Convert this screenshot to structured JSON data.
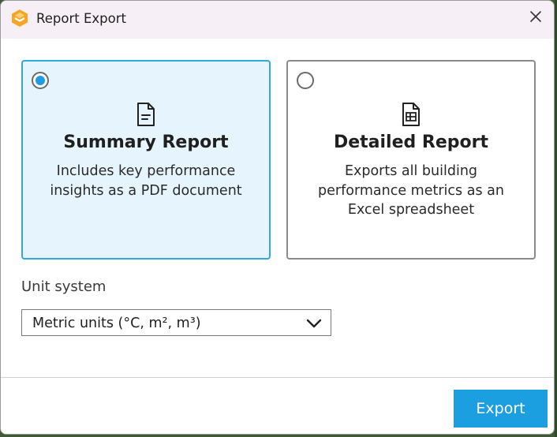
{
  "window": {
    "title": "Report Export",
    "app_icon": "report-export-logo-icon",
    "close_icon": "close-icon"
  },
  "options": [
    {
      "id": "summary",
      "selected": true,
      "icon": "document-icon",
      "title": "Summary Report",
      "description": "Includes key performance insights as a PDF document"
    },
    {
      "id": "detailed",
      "selected": false,
      "icon": "spreadsheet-icon",
      "title": "Detailed Report",
      "description": "Exports all building performance metrics as an Excel spreadsheet"
    }
  ],
  "unit_system": {
    "label": "Unit system",
    "selected_value": "Metric units (°C, m², m³)",
    "chevron_icon": "chevron-down-icon"
  },
  "footer": {
    "export_label": "Export"
  },
  "colors": {
    "accent": "#1c9fe0",
    "selected_card_bg": "#e6f4fd",
    "selected_card_border": "#33a6e0",
    "logo": "#f5a623"
  }
}
